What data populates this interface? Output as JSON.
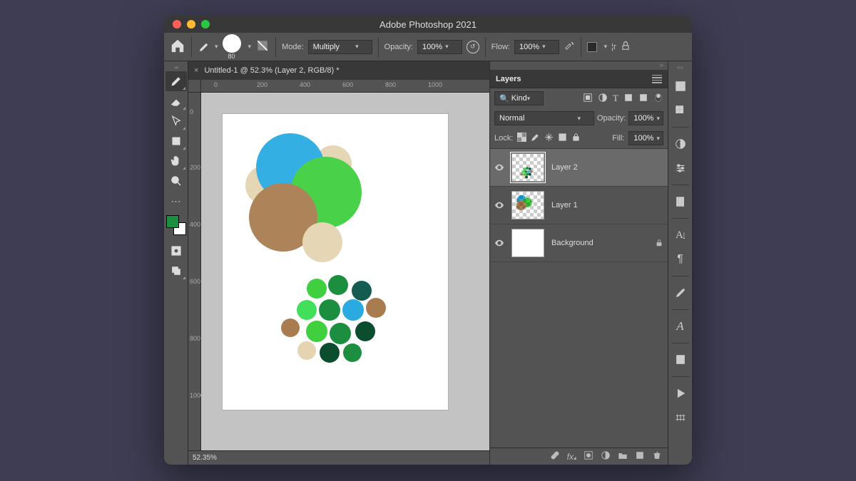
{
  "window": {
    "title": "Adobe Photoshop 2021"
  },
  "options": {
    "brush_size": "80",
    "mode_label": "Mode:",
    "mode_value": "Multiply",
    "opacity_label": "Opacity:",
    "opacity_value": "100%",
    "flow_label": "Flow:",
    "flow_value": "100%"
  },
  "document": {
    "tab_title": "Untitled-1 @ 52.3% (Layer 2, RGB/8) *",
    "zoom_status": "52.35%",
    "ruler_h": [
      "0",
      "200",
      "400",
      "600",
      "800",
      "1000"
    ],
    "ruler_v": [
      "0",
      "200",
      "400",
      "600",
      "800",
      "1000"
    ]
  },
  "layers_panel": {
    "title": "Layers",
    "filter_kind": "Kind",
    "blend_mode": "Normal",
    "opacity_label": "Opacity:",
    "opacity_value": "100%",
    "lock_label": "Lock:",
    "fill_label": "Fill:",
    "fill_value": "100%",
    "layers": [
      {
        "name": "Layer 2",
        "selected": true,
        "locked": false,
        "checker": true
      },
      {
        "name": "Layer 1",
        "selected": false,
        "locked": false,
        "checker": true
      },
      {
        "name": "Background",
        "selected": false,
        "locked": true,
        "checker": false
      }
    ]
  },
  "swatches": {
    "fg": "#1b8f3f",
    "bg": "#ffffff"
  }
}
